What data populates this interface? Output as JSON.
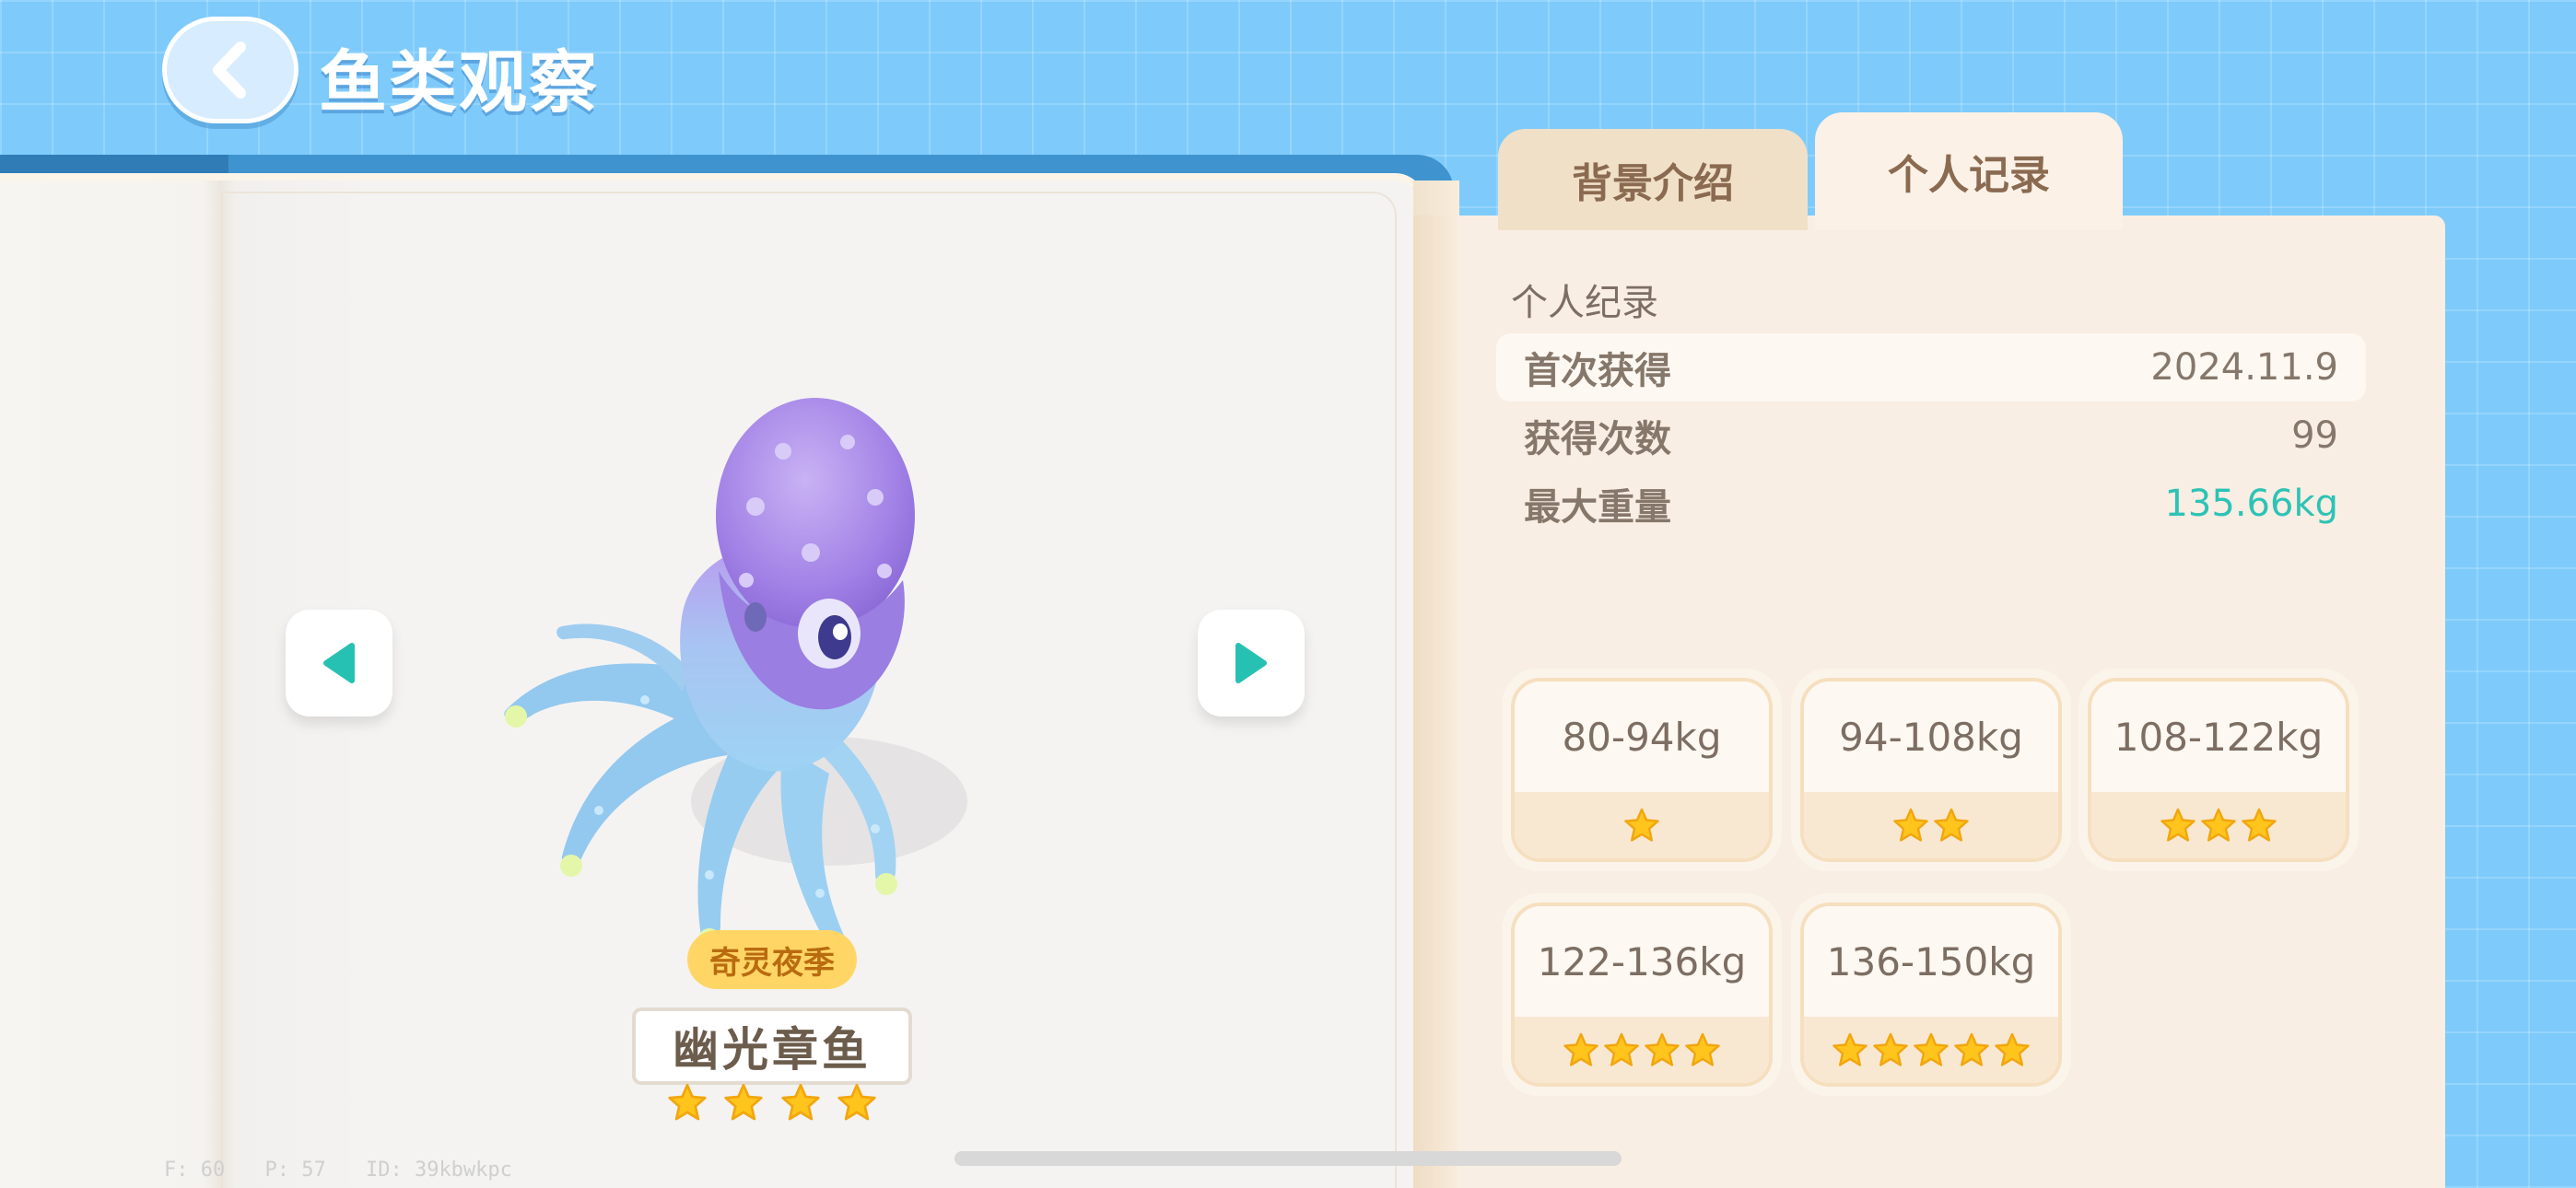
{
  "header": {
    "title": "鱼类观察"
  },
  "fish": {
    "event_badge": "奇灵夜季",
    "name": "幽光章鱼",
    "rarity_stars": 4
  },
  "tabs": [
    {
      "label": "背景介绍",
      "active": false
    },
    {
      "label": "个人记录",
      "active": true
    }
  ],
  "record": {
    "section_title": "个人纪录",
    "rows": [
      {
        "label": "首次获得",
        "value": "2024.11.9"
      },
      {
        "label": "获得次数",
        "value": "99"
      },
      {
        "label": "最大重量",
        "value": "135.66kg"
      }
    ]
  },
  "weight_tiers": [
    {
      "range": "80-94kg",
      "stars": 1
    },
    {
      "range": "94-108kg",
      "stars": 2
    },
    {
      "range": "108-122kg",
      "stars": 3
    },
    {
      "range": "122-136kg",
      "stars": 4
    },
    {
      "range": "136-150kg",
      "stars": 5
    }
  ],
  "debug": {
    "fps": "F: 60",
    "ping": "P: 57",
    "id": "ID: 39kbwkpc"
  },
  "colors": {
    "accent": "#2dc3b6",
    "star": "#ffc51d",
    "background": "#7ecbfb"
  },
  "icons": {
    "back": "chevron-left-icon",
    "prev": "triangle-left-icon",
    "next": "triangle-right-icon",
    "star": "star-icon"
  }
}
